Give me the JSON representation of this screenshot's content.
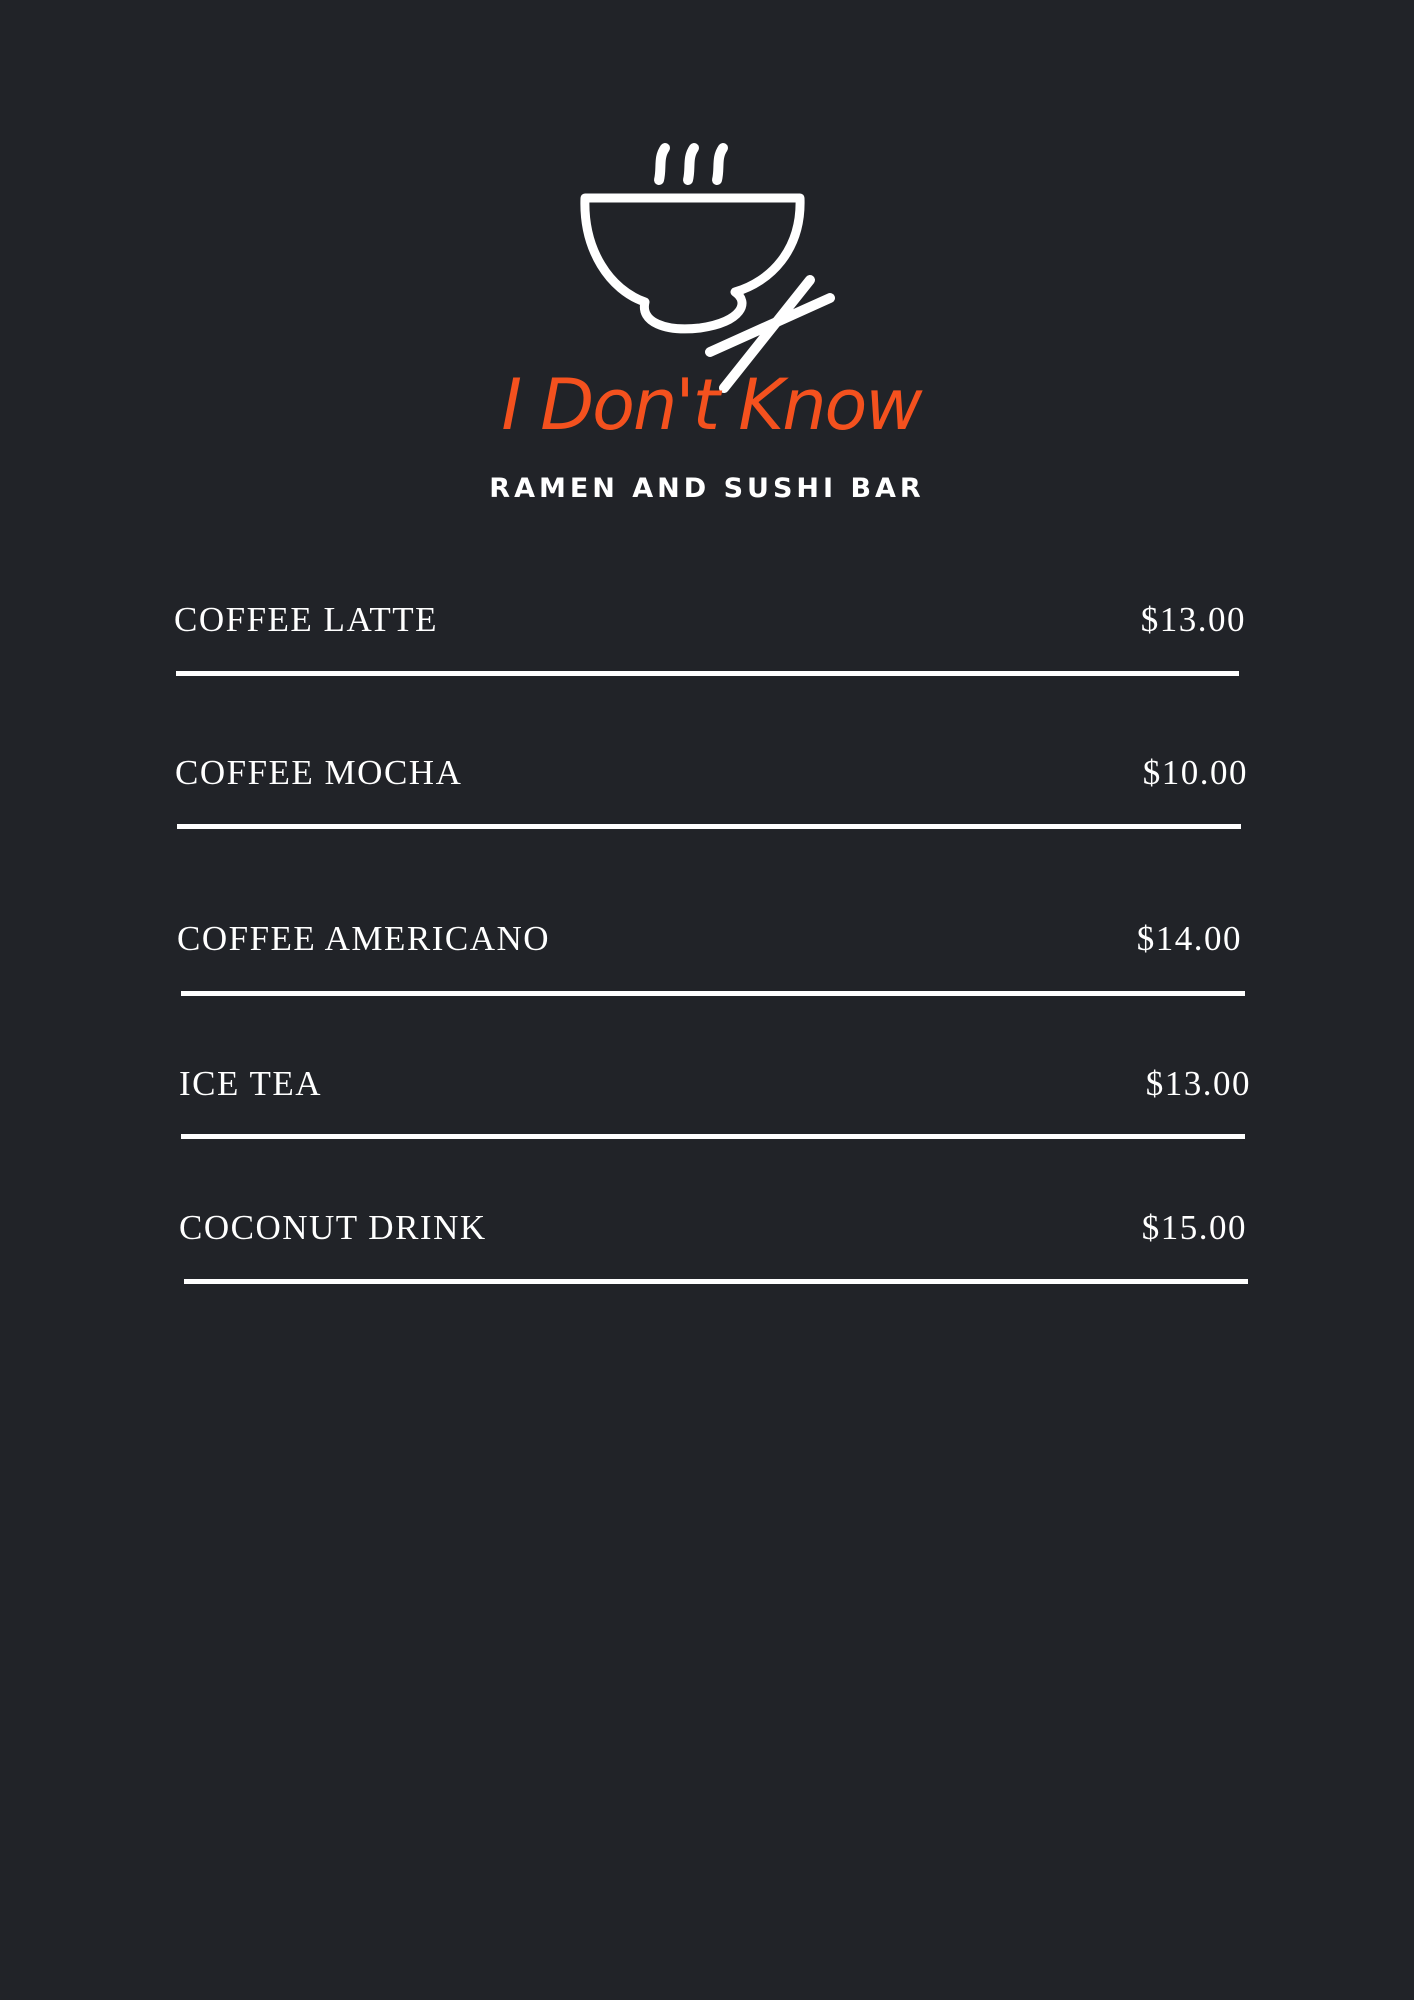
{
  "colors": {
    "background": "#212328",
    "accent": "#f4511e",
    "text": "#ffffff"
  },
  "brand": {
    "logo_icon": "ramen-bowl-with-chopsticks-icon",
    "name": "I Don't Know",
    "tagline": "RAMEN AND SUSHI BAR"
  },
  "menu": {
    "items": [
      {
        "name": "COFFEE LATTE",
        "price": "$13.00"
      },
      {
        "name": "COFFEE MOCHA",
        "price": "$10.00"
      },
      {
        "name": "COFFEE AMERICANO",
        "price": "$14.00"
      },
      {
        "name": "ICE TEA",
        "price": "$13.00"
      },
      {
        "name": "COCONUT DRINK",
        "price": "$15.00"
      }
    ]
  }
}
